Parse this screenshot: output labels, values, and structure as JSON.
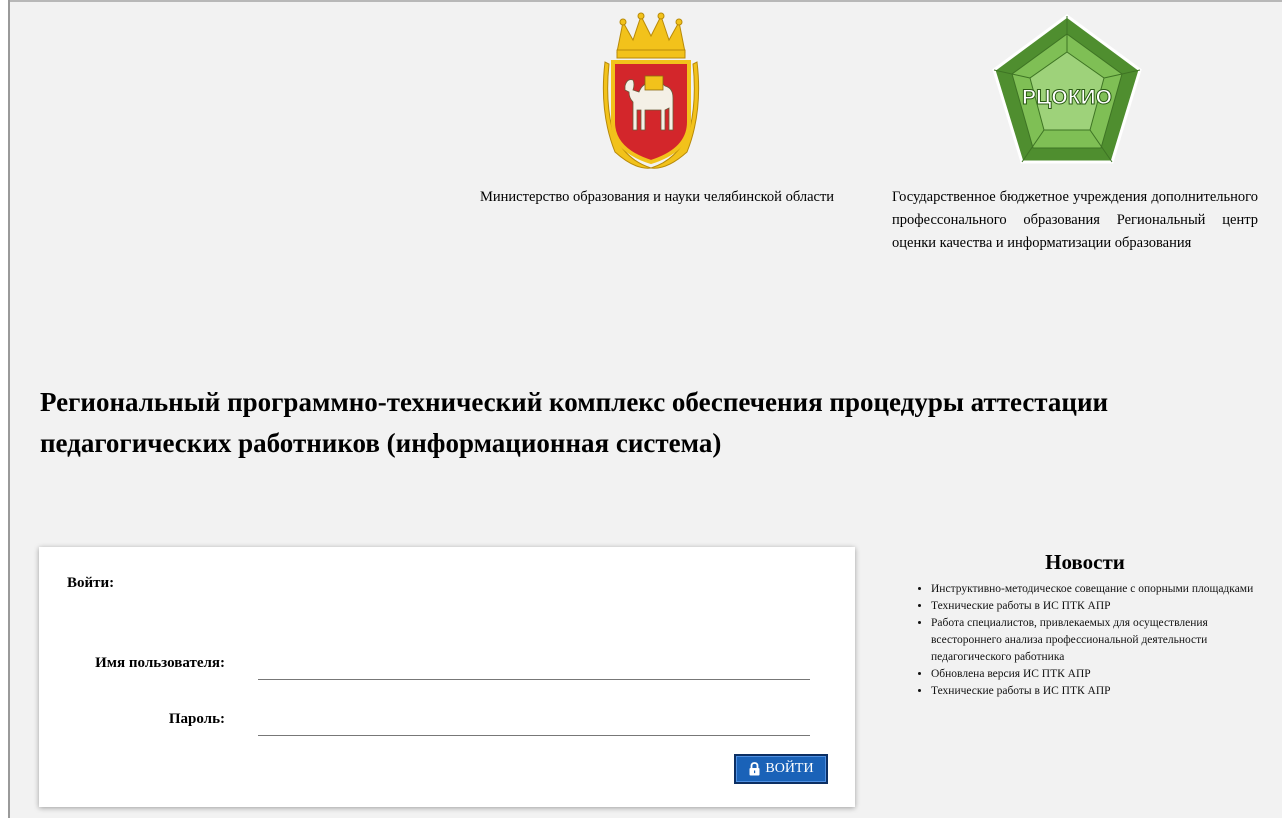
{
  "header": {
    "ministry_text": "Министерство образования и науки челябинской области",
    "center_text": "Государственное бюджетное учреждения дополнительного профессонального образования Региональный центр оценки качества и информатизации образования",
    "logo_text": "РЦОКИО"
  },
  "main": {
    "title": "Региональный программно-технический комплекс обеспечения процедуры аттестации педагогических работников (информационная система)"
  },
  "login": {
    "heading": "Войти:",
    "username_label": "Имя пользователя:",
    "password_label": "Пароль:",
    "username_value": "",
    "password_value": "",
    "button_label": "ВОЙТИ"
  },
  "news": {
    "title": "Новости",
    "items": [
      "Инструктивно-методическое совещание с опорными площадками",
      "Технические работы в ИС ПТК АПР",
      "Работа специалистов, привлекаемых для осуществления всестороннего анализа профессиональной деятельности педагогического работника",
      "Обновлена версия ИС ПТК АПР",
      "Технические работы в ИС ПТК АПР"
    ]
  },
  "colors": {
    "page_background": "#f2f2f2",
    "button_blue": "#1a62b8",
    "emblem_red": "#d3262b",
    "logo_green": "#5a9e3a"
  },
  "icons": [
    "chelyabinsk-coat-of-arms",
    "rcoko-logo",
    "lock-icon"
  ]
}
